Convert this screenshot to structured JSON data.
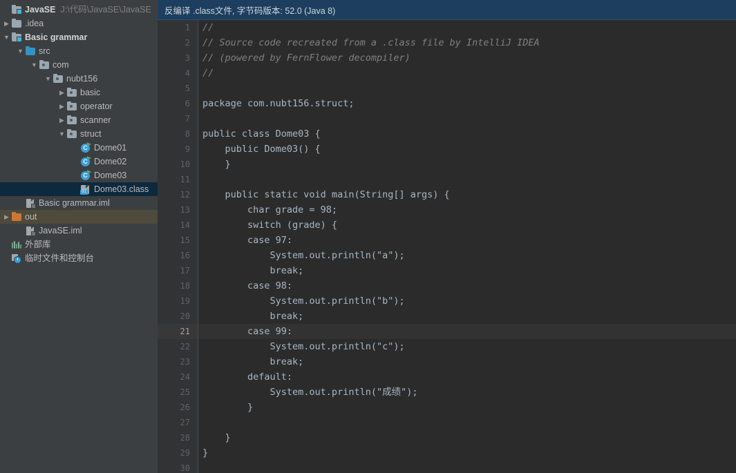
{
  "sidebar": {
    "tree": [
      {
        "depth": 0,
        "arrow": "",
        "icon": "folder-module-icon",
        "label": "JavaSE",
        "bold": true,
        "path": "J:\\代码\\JavaSE\\JavaSE",
        "state": "normal"
      },
      {
        "depth": 0,
        "arrow": "▶",
        "icon": "folder-icon",
        "label": ".idea",
        "bold": false,
        "path": "",
        "state": "normal"
      },
      {
        "depth": 0,
        "arrow": "▼",
        "icon": "folder-module-icon",
        "label": "Basic grammar",
        "bold": true,
        "path": "",
        "state": "normal"
      },
      {
        "depth": 1,
        "arrow": "▼",
        "icon": "folder-source-root-icon",
        "label": "src",
        "bold": false,
        "path": "",
        "state": "normal"
      },
      {
        "depth": 2,
        "arrow": "▼",
        "icon": "package-icon",
        "label": "com",
        "bold": false,
        "path": "",
        "state": "normal"
      },
      {
        "depth": 3,
        "arrow": "▼",
        "icon": "package-icon",
        "label": "nubt156",
        "bold": false,
        "path": "",
        "state": "normal"
      },
      {
        "depth": 4,
        "arrow": "▶",
        "icon": "package-icon",
        "label": "basic",
        "bold": false,
        "path": "",
        "state": "normal"
      },
      {
        "depth": 4,
        "arrow": "▶",
        "icon": "package-icon",
        "label": "operator",
        "bold": false,
        "path": "",
        "state": "normal"
      },
      {
        "depth": 4,
        "arrow": "▶",
        "icon": "package-icon",
        "label": "scanner",
        "bold": false,
        "path": "",
        "state": "normal"
      },
      {
        "depth": 4,
        "arrow": "▼",
        "icon": "package-icon",
        "label": "struct",
        "bold": false,
        "path": "",
        "state": "normal"
      },
      {
        "depth": 5,
        "arrow": "",
        "icon": "java-class-icon",
        "label": "Dome01",
        "bold": false,
        "path": "",
        "state": "normal"
      },
      {
        "depth": 5,
        "arrow": "",
        "icon": "java-class-icon",
        "label": "Dome02",
        "bold": false,
        "path": "",
        "state": "normal"
      },
      {
        "depth": 5,
        "arrow": "",
        "icon": "java-class-icon",
        "label": "Dome03",
        "bold": false,
        "path": "",
        "state": "normal"
      },
      {
        "depth": 5,
        "arrow": "",
        "icon": "class-file-icon",
        "label": "Dome03.class",
        "bold": false,
        "path": "",
        "state": "selected"
      },
      {
        "depth": 1,
        "arrow": "",
        "icon": "iml-file-icon",
        "label": "Basic grammar.iml",
        "bold": false,
        "path": "",
        "state": "normal"
      },
      {
        "depth": 0,
        "arrow": "▶",
        "icon": "folder-out-icon",
        "label": "out",
        "bold": false,
        "path": "",
        "state": "hovered"
      },
      {
        "depth": 1,
        "arrow": "",
        "icon": "iml-file-icon",
        "label": "JavaSE.iml",
        "bold": false,
        "path": "",
        "state": "normal"
      },
      {
        "depth": 0,
        "arrow": "",
        "icon": "external-libraries-icon",
        "label": "外部库",
        "bold": false,
        "path": "",
        "state": "normal"
      },
      {
        "depth": 0,
        "arrow": "",
        "icon": "scratches-icon",
        "label": "临时文件和控制台",
        "bold": false,
        "path": "",
        "state": "normal"
      }
    ]
  },
  "editor": {
    "banner": "反编译 .class文件, 字节码版本: 52.0 (Java 8)",
    "caret_line": 21,
    "lines": [
      {
        "n": 1,
        "text": "//",
        "comment": true
      },
      {
        "n": 2,
        "text": "// Source code recreated from a .class file by IntelliJ IDEA",
        "comment": true
      },
      {
        "n": 3,
        "text": "// (powered by FernFlower decompiler)",
        "comment": true
      },
      {
        "n": 4,
        "text": "//",
        "comment": true
      },
      {
        "n": 5,
        "text": "",
        "comment": false
      },
      {
        "n": 6,
        "text": "package com.nubt156.struct;",
        "comment": false
      },
      {
        "n": 7,
        "text": "",
        "comment": false
      },
      {
        "n": 8,
        "text": "public class Dome03 {",
        "comment": false
      },
      {
        "n": 9,
        "text": "    public Dome03() {",
        "comment": false
      },
      {
        "n": 10,
        "text": "    }",
        "comment": false
      },
      {
        "n": 11,
        "text": "",
        "comment": false
      },
      {
        "n": 12,
        "text": "    public static void main(String[] args) {",
        "comment": false
      },
      {
        "n": 13,
        "text": "        char grade = 98;",
        "comment": false
      },
      {
        "n": 14,
        "text": "        switch (grade) {",
        "comment": false
      },
      {
        "n": 15,
        "text": "        case 97:",
        "comment": false
      },
      {
        "n": 16,
        "text": "            System.out.println(\"a\");",
        "comment": false
      },
      {
        "n": 17,
        "text": "            break;",
        "comment": false
      },
      {
        "n": 18,
        "text": "        case 98:",
        "comment": false
      },
      {
        "n": 19,
        "text": "            System.out.println(\"b\");",
        "comment": false
      },
      {
        "n": 20,
        "text": "            break;",
        "comment": false
      },
      {
        "n": 21,
        "text": "        case 99:",
        "comment": false
      },
      {
        "n": 22,
        "text": "            System.out.println(\"c\");",
        "comment": false
      },
      {
        "n": 23,
        "text": "            break;",
        "comment": false
      },
      {
        "n": 24,
        "text": "        default:",
        "comment": false
      },
      {
        "n": 25,
        "text": "            System.out.println(\"成绩\");",
        "comment": false
      },
      {
        "n": 26,
        "text": "        }",
        "comment": false
      },
      {
        "n": 27,
        "text": "",
        "comment": false
      },
      {
        "n": 28,
        "text": "    }",
        "comment": false
      },
      {
        "n": 29,
        "text": "}",
        "comment": false
      },
      {
        "n": 30,
        "text": "",
        "comment": false
      }
    ]
  },
  "colors": {
    "sidebar_bg": "#3c3f41",
    "editor_bg": "#2b2b2b",
    "banner_bg": "#1e3e5f",
    "selection_bg": "#0d293e",
    "hover_bg": "#4e4a3c",
    "code_fg": "#a9b7c6",
    "comment_fg": "#808080",
    "gutter_fg": "#606366"
  }
}
